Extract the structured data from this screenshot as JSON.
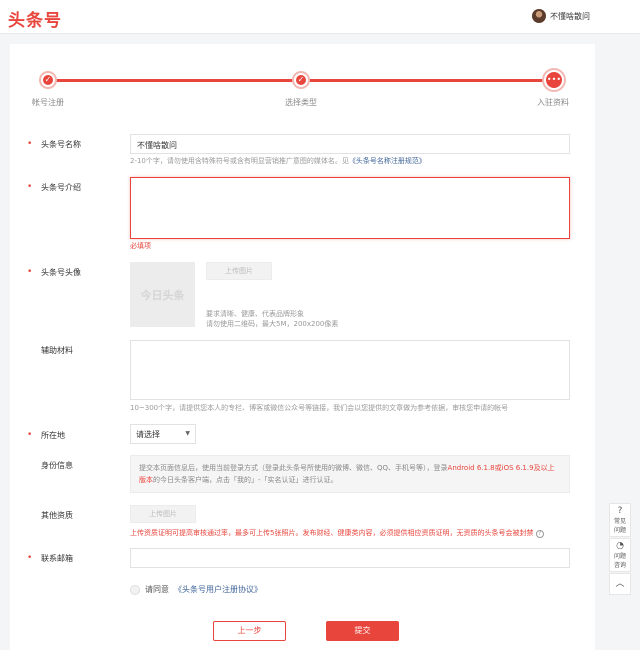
{
  "header": {
    "logo": "头条号",
    "user_name": "不懂啥散问"
  },
  "steps": [
    {
      "label": "帐号注册",
      "symbol": "✓"
    },
    {
      "label": "选择类型",
      "symbol": "✓"
    },
    {
      "label": "入驻资料",
      "symbol": "•••"
    }
  ],
  "form": {
    "name": {
      "label": "头条号名称",
      "required": "•",
      "value": "不懂啥散问",
      "hint": "2-10个字，请勿使用含特殊符号或含有明显营销推广意图的媒体名。见",
      "hint_link": "《头条号名称注册规范》"
    },
    "intro": {
      "label": "头条号介绍",
      "required": "•",
      "value": "",
      "error": "必填项"
    },
    "avatar": {
      "label": "头条号头像",
      "required": "•",
      "placeholder_text": "今日头条",
      "upload_label": "上传图片",
      "hint_line1": "要求清晰、健康、代表品牌形象",
      "hint_line2": "请勿使用二维码，最大5M，200x200像素"
    },
    "aux": {
      "label": "辅助材料",
      "value": "",
      "hint": "10~300个字，请提供您本人的专栏、博客或微信公众号等链接，我们会以您提供的文章做为参考依据，审核您申请的帐号"
    },
    "location": {
      "label": "所在地",
      "required": "•",
      "select_value": "请选择",
      "caret": "▼"
    },
    "identity": {
      "label": "身份信息",
      "text_part1": "提交本页面信息后，使用当前登录方式（登录此头条号所使用的微博、微信、QQ、手机号等），登录",
      "text_red": "Android 6.1.8或iOS 6.1.9及以上版本",
      "text_part2": "的今日头条客户端，点击「我的」-「实名认证」进行认证。"
    },
    "other": {
      "label": "其他资质",
      "upload_label": "上传图片",
      "warning": "上传资质证明可提高审核通过率，最多可上传5张照片。发布财经、健康类内容，必须提供相应资质证明，无资质的头条号会被封禁",
      "help_icon": "?"
    },
    "email": {
      "label": "联系邮箱",
      "required": "•",
      "value": ""
    },
    "agreement": {
      "prefix": "请同意",
      "link": "《头条号用户注册协议》"
    },
    "buttons": {
      "prev": "上一步",
      "submit": "提交"
    }
  },
  "side_tools": [
    {
      "icon": "?",
      "label": "常见问题"
    },
    {
      "icon": "◔",
      "label": "问题咨询"
    },
    {
      "icon": "︿",
      "label": ""
    }
  ]
}
